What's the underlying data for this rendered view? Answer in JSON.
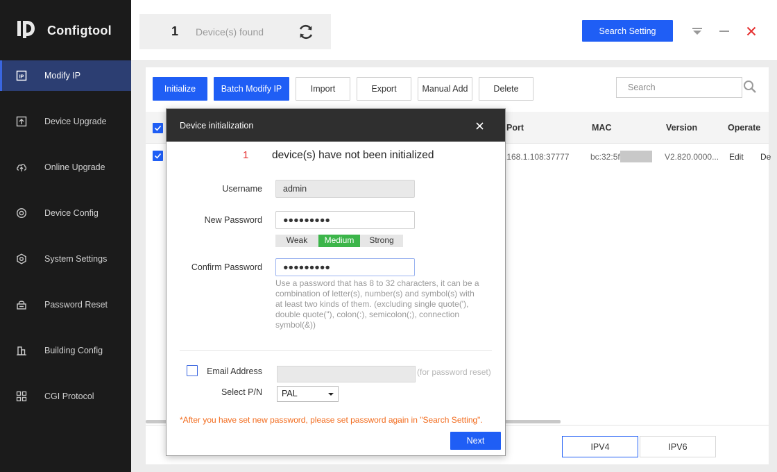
{
  "app": {
    "name": "Configtool"
  },
  "sidebar": {
    "items": [
      {
        "label": "Modify IP",
        "icon": "modify-ip-icon",
        "active": true
      },
      {
        "label": "Device Upgrade",
        "icon": "device-upgrade-icon"
      },
      {
        "label": "Online Upgrade",
        "icon": "online-upgrade-icon"
      },
      {
        "label": "Device Config",
        "icon": "device-config-icon"
      },
      {
        "label": "System Settings",
        "icon": "system-settings-icon"
      },
      {
        "label": "Password Reset",
        "icon": "password-reset-icon"
      },
      {
        "label": "Building Config",
        "icon": "building-config-icon"
      },
      {
        "label": "CGI Protocol",
        "icon": "cgi-protocol-icon"
      }
    ]
  },
  "topbar": {
    "device_count": "1",
    "devices_found_label": "Device(s) found",
    "search_setting_label": "Search Setting"
  },
  "toolbar": {
    "initialize": "Initialize",
    "batch_modify_ip": "Batch Modify IP",
    "import": "Import",
    "export": "Export",
    "manual_add": "Manual Add",
    "delete": "Delete",
    "search_placeholder": "Search"
  },
  "table": {
    "headers": {
      "port": "Port",
      "mac": "MAC",
      "version": "Version",
      "operate": "Operate"
    },
    "rows": [
      {
        "ip_port": ".168.1.108:37777",
        "mac": "bc:32:5f",
        "version": "V2.820.0000...",
        "edit": "Edit",
        "delete": "De"
      }
    ]
  },
  "ip_mode": {
    "ipv4": "IPV4",
    "ipv6": "IPV6",
    "selected": "IPV4"
  },
  "dialog": {
    "title": "Device initialization",
    "count": "1",
    "message": "device(s) have not been initialized",
    "username_label": "Username",
    "username_value": "admin",
    "new_password_label": "New Password",
    "new_password_value": "●●●●●●●●●",
    "strength": {
      "weak": "Weak",
      "medium": "Medium",
      "strong": "Strong",
      "current": "Medium"
    },
    "confirm_password_label": "Confirm Password",
    "confirm_password_value": "●●●●●●●●●",
    "password_hint": "Use a password that has 8 to 32 characters, it can be a combination of letter(s), number(s) and symbol(s) with at least two kinds of them. (excluding single quote('), double quote(\"), colon(:), semicolon(;), connection symbol(&))",
    "email_label": "Email Address",
    "email_hint": "(for password reset)",
    "select_pn_label": "Select P/N",
    "select_pn_value": "PAL",
    "warning": "*After you have set new password, please set password again in \"Search Setting\".",
    "next_label": "Next"
  },
  "colors": {
    "accent": "#1f5ef5",
    "sidebar_bg": "#1b1b1b",
    "strength_medium": "#3cb54a",
    "warning": "#f26b1d",
    "count_red": "#e53030"
  }
}
